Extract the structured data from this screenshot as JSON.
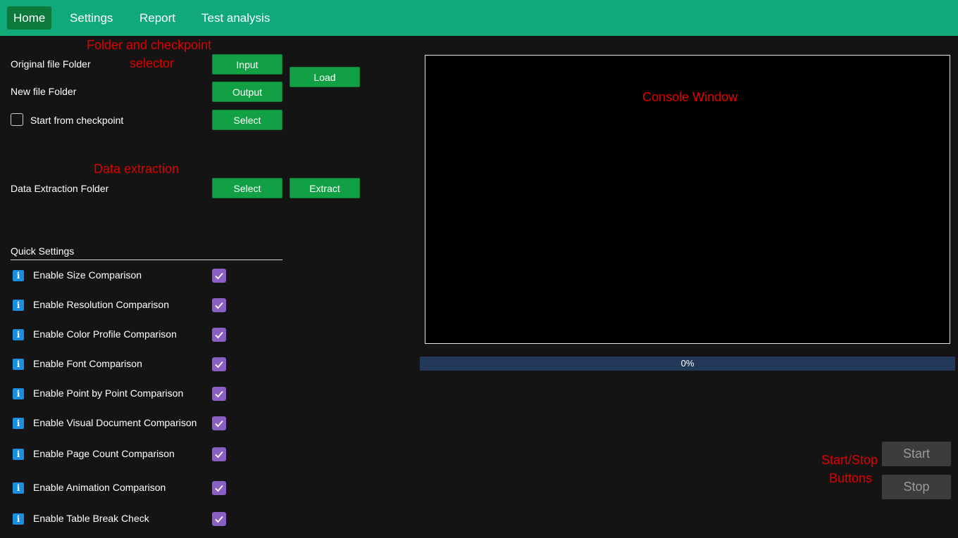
{
  "nav": {
    "items": [
      {
        "label": "Home",
        "active": true
      },
      {
        "label": "Settings",
        "active": false
      },
      {
        "label": "Report",
        "active": false
      },
      {
        "label": "Test analysis",
        "active": false
      }
    ]
  },
  "annotations": {
    "folder_selector_line1": "Folder and checkpoint",
    "folder_selector_line2": "selector",
    "data_extraction": "Data extraction",
    "console": "Console Window",
    "start_stop_line1": "Start/Stop",
    "start_stop_line2": "Buttons"
  },
  "folders": {
    "original_label": "Original file Folder",
    "original_button": "Input",
    "new_label": "New file Folder",
    "new_button": "Output",
    "load_button": "Load",
    "checkpoint_label": "Start from checkpoint",
    "checkpoint_checked": false,
    "checkpoint_button": "Select"
  },
  "extraction": {
    "label": "Data Extraction Folder",
    "select_button": "Select",
    "extract_button": "Extract"
  },
  "quick_settings": {
    "title": "Quick Settings",
    "items": [
      {
        "label": "Enable Size Comparison",
        "checked": true
      },
      {
        "label": "Enable Resolution Comparison",
        "checked": true
      },
      {
        "label": "Enable Color Profile Comparison",
        "checked": true
      },
      {
        "label": "Enable Font Comparison",
        "checked": true
      },
      {
        "label": "Enable Point by Point Comparison",
        "checked": true
      },
      {
        "label": "Enable Visual Document Comparison",
        "checked": true
      },
      {
        "label": "Enable Page Count Comparison",
        "checked": true
      },
      {
        "label": "Enable Animation Comparison",
        "checked": true
      },
      {
        "label": "Enable Table Break Check",
        "checked": true
      }
    ]
  },
  "progress": {
    "value": 0,
    "label": "0%"
  },
  "controls": {
    "start_label": "Start",
    "stop_label": "Stop"
  },
  "colors": {
    "topbar": "#0fa97a",
    "active_tab": "#0b7a3a",
    "button": "#12a045",
    "checkbox": "#8a5fc4",
    "info_icon": "#1a8fe0",
    "annotation": "#e00000",
    "progress": "#23395a"
  }
}
